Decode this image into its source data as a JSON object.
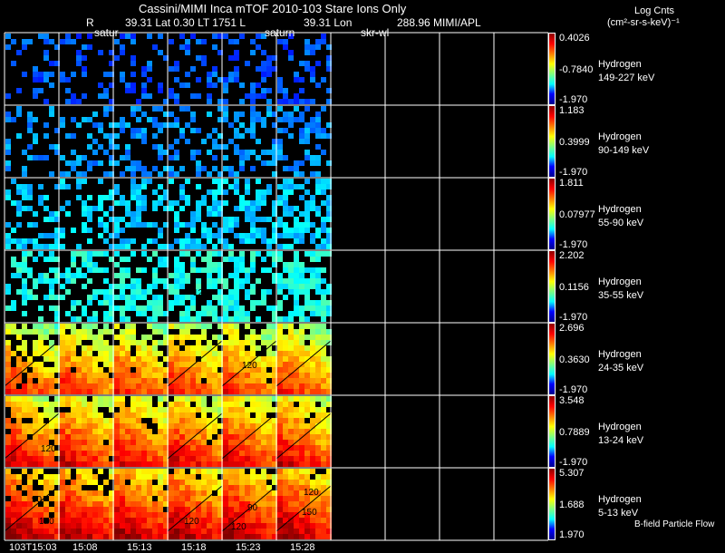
{
  "header": {
    "title": "Cassini/MIMI Inca mTOF  2010-103   Stare   Ions Only",
    "r_label": "R",
    "info": "39.31 Lat 0.30 LT 1751 L",
    "lon_value": "39.31 Lon",
    "lon_extra": "288.96  MIMI/APL",
    "overlay_labels": [
      "satur",
      "saturn",
      "skr-wl"
    ]
  },
  "units": {
    "line1": "Log Cnts",
    "line2": "(cm²-sr-s-keV)⁻¹"
  },
  "footer_note": "B-field Particle Flow",
  "chart_data": {
    "type": "heatmap",
    "time_labels": [
      "103T15:03",
      "15:08",
      "15:13",
      "15:18",
      "15:23",
      "15:28"
    ],
    "columns_total": 10,
    "rows": [
      {
        "species": "Hydrogen",
        "energy": "149-227 keV",
        "max": "0.4026",
        "mid": "-0.7840",
        "min": "-1.970"
      },
      {
        "species": "Hydrogen",
        "energy": "90-149 keV",
        "max": "1.183",
        "mid": "0.3999",
        "min": "-1.970"
      },
      {
        "species": "Hydrogen",
        "energy": "55-90 keV",
        "max": "1.811",
        "mid": "0.07977",
        "min": "-1.970"
      },
      {
        "species": "Hydrogen",
        "energy": "35-55 keV",
        "max": "2.202",
        "mid": "0.1156",
        "min": "-1.970"
      },
      {
        "species": "Hydrogen",
        "energy": "24-35 keV",
        "max": "2.696",
        "mid": "0.3630",
        "min": "-1.970"
      },
      {
        "species": "Hydrogen",
        "energy": "13-24 keV",
        "max": "3.548",
        "mid": "0.7889",
        "min": "-1.970"
      },
      {
        "species": "Hydrogen",
        "energy": "5-13 keV",
        "max": "5.307",
        "mid": "1.688",
        "min": "1.970"
      }
    ],
    "colormap": "jet",
    "contour_labels": [
      "90",
      "120",
      "150"
    ]
  }
}
